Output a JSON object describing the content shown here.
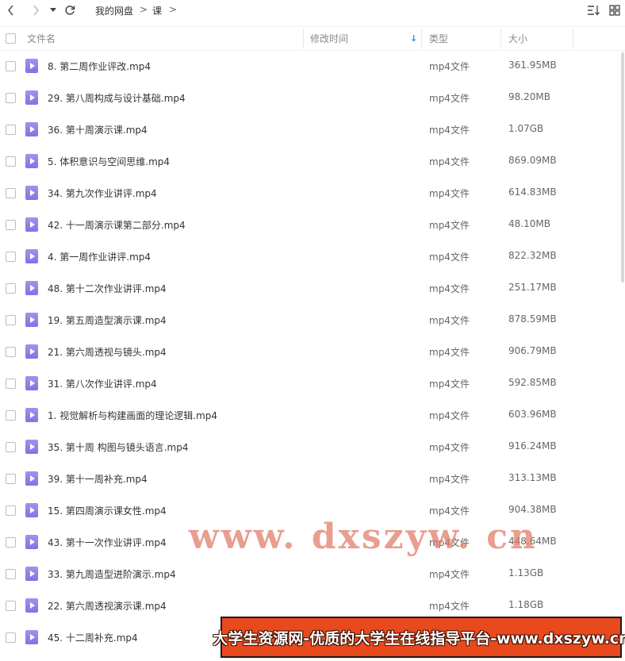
{
  "toolbar": {
    "back_icon": "chevron-left-icon",
    "forward_icon": "chevron-right-icon",
    "history_icon": "caret-down-icon",
    "refresh_icon": "refresh-icon",
    "breadcrumb": [
      {
        "label": "我的网盘"
      },
      {
        "label": "课"
      }
    ],
    "separator": ">",
    "sort_icon": "sort-icon",
    "grid_icon": "grid-view-icon"
  },
  "columns": {
    "name": "文件名",
    "modified": "修改时间",
    "type": "类型",
    "size": "大小",
    "sort_indicator": "↓",
    "sort_color": "#1a8cff"
  },
  "files": [
    {
      "name": "8. 第二周作业评改.mp4",
      "type": "mp4文件",
      "size": "361.95MB"
    },
    {
      "name": "29. 第八周构成与设计基础.mp4",
      "type": "mp4文件",
      "size": "98.20MB"
    },
    {
      "name": "36. 第十周演示课.mp4",
      "type": "mp4文件",
      "size": "1.07GB"
    },
    {
      "name": "5. 体积意识与空间思维.mp4",
      "type": "mp4文件",
      "size": "869.09MB"
    },
    {
      "name": "34. 第九次作业讲评.mp4",
      "type": "mp4文件",
      "size": "614.83MB"
    },
    {
      "name": "42. 十一周演示课第二部分.mp4",
      "type": "mp4文件",
      "size": "48.10MB"
    },
    {
      "name": "4. 第一周作业讲评.mp4",
      "type": "mp4文件",
      "size": "822.32MB"
    },
    {
      "name": "48. 第十二次作业讲评.mp4",
      "type": "mp4文件",
      "size": "251.17MB"
    },
    {
      "name": "19. 第五周造型演示课.mp4",
      "type": "mp4文件",
      "size": "878.59MB"
    },
    {
      "name": "21. 第六周透视与镜头.mp4",
      "type": "mp4文件",
      "size": "906.79MB"
    },
    {
      "name": "31. 第八次作业讲评.mp4",
      "type": "mp4文件",
      "size": "592.85MB"
    },
    {
      "name": "1. 视觉解析与构建画面的理论逻辑.mp4",
      "type": "mp4文件",
      "size": "603.96MB"
    },
    {
      "name": "35. 第十周 构图与镜头语言.mp4",
      "type": "mp4文件",
      "size": "916.24MB"
    },
    {
      "name": "39. 第十一周补充.mp4",
      "type": "mp4文件",
      "size": "313.13MB"
    },
    {
      "name": "15. 第四周演示课女性.mp4",
      "type": "mp4文件",
      "size": "904.38MB"
    },
    {
      "name": "43. 第十一次作业讲评.mp4",
      "type": "mp4文件",
      "size": "448.64MB"
    },
    {
      "name": "33. 第九周造型进阶演示.mp4",
      "type": "mp4文件",
      "size": "1.13GB"
    },
    {
      "name": "22. 第六周透视演示课.mp4",
      "type": "mp4文件",
      "size": "1.18GB"
    },
    {
      "name": "45. 十二周补充.mp4",
      "type": "",
      "size": ""
    }
  ],
  "watermark": {
    "text": "www. dxszyw. cn",
    "banner": "大学生资源网-优质的大学生在线指导平台-www.dxszyw.cn",
    "banner_color": "#e8491d"
  }
}
